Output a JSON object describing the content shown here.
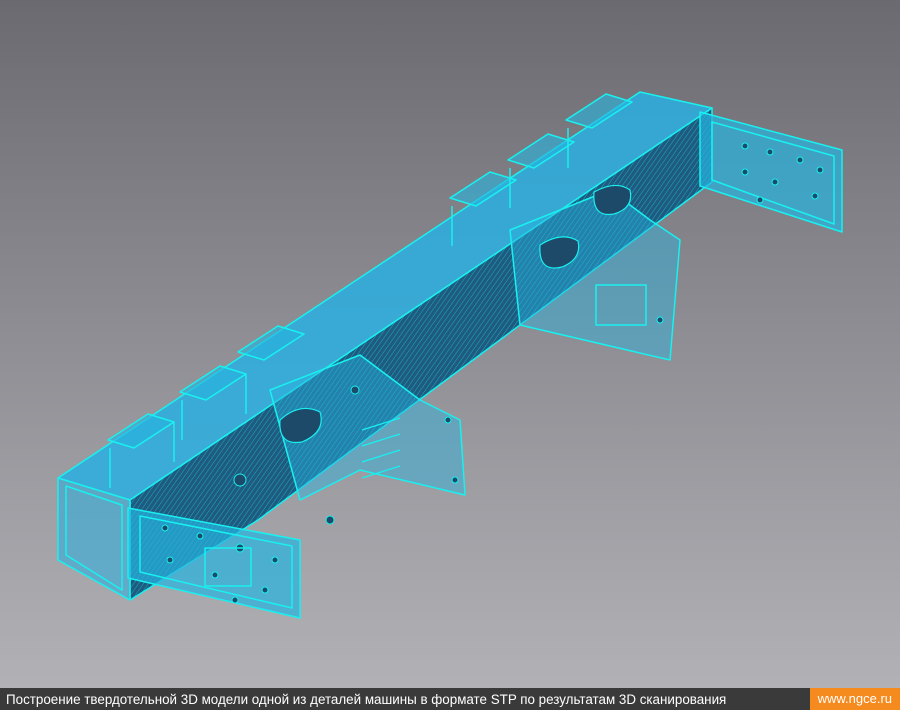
{
  "caption": {
    "text": "Построение твердотельной 3D модели одной из деталей машины в формате STP по результатам 3D сканирования",
    "site": "www.ngce.ru"
  },
  "render": {
    "icon": "cad-wireframe-model",
    "colors": {
      "edge": "#19f0f0",
      "fill": "#27b4e0",
      "dark_face": "#1e4a6a",
      "background_top": "#6a6a70",
      "background_bottom": "#b4b4b8",
      "caption_bar": "#3a3a3a",
      "site_badge": "#f58a1f"
    }
  }
}
